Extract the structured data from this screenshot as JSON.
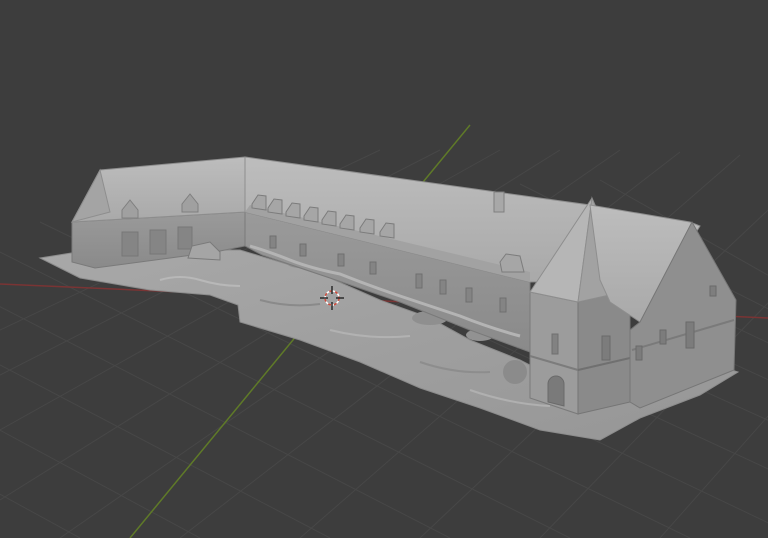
{
  "viewport": {
    "view": "3D viewport",
    "shading": "solid",
    "colors": {
      "background": "#3d3d3d",
      "grid_line": "#4a4a4a",
      "x_axis": "#8a3a3a",
      "y_axis": "#6b8a2a",
      "mesh_light": "#b4b4b4",
      "mesh_mid": "#9a9a9a",
      "mesh_dark": "#7e7e7e",
      "cursor_red": "#d04a3a"
    },
    "object": {
      "type": "photogrammetry-mesh",
      "description_icon": "mesh-icon"
    },
    "cursor_icon": "3d-cursor-icon"
  }
}
